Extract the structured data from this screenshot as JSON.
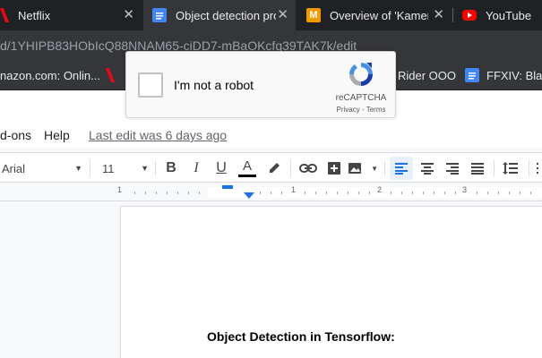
{
  "tabs": [
    {
      "label": "Netflix",
      "favicon": "netflix-icon",
      "active": false
    },
    {
      "label": "Object detection pro",
      "favicon": "google-docs-icon",
      "active": true
    },
    {
      "label": "Overview of 'Kamen",
      "favicon": "m-logo-icon",
      "active": false
    },
    {
      "label": "YouTube",
      "favicon": "youtube-icon",
      "active": false
    }
  ],
  "address": {
    "url": "d/1YHIPB83HObIcQ88NNAM65-ciDD7-mBaOKcfq39TAK7k/edit"
  },
  "bookmarks": [
    {
      "label": "nazon.com: Onlin..."
    },
    {
      "label": "Rider OOO"
    },
    {
      "label": "FFXIV: Black"
    }
  ],
  "docs_menu": {
    "items": [
      "d-ons",
      "Help"
    ],
    "last_edit": "Last edit was 6 days ago"
  },
  "toolbar": {
    "font": "Arial",
    "font_size": "11",
    "bold": "B",
    "italic": "I",
    "underline": "U",
    "text_color": "A"
  },
  "ruler": {
    "numbers": [
      "1",
      "1",
      "2",
      "3"
    ]
  },
  "document": {
    "title": "Object Detection in Tensorflow:"
  },
  "recaptcha": {
    "label": "I'm not a robot",
    "brand": "reCAPTCHA",
    "links": "Privacy - Terms"
  },
  "colors": {
    "tab_bar": "#202124",
    "chrome": "#35363a",
    "docs_blue": "#4285f4",
    "netflix_red": "#e50914",
    "youtube_red": "#ff0000",
    "m_orange": "#f29900"
  }
}
